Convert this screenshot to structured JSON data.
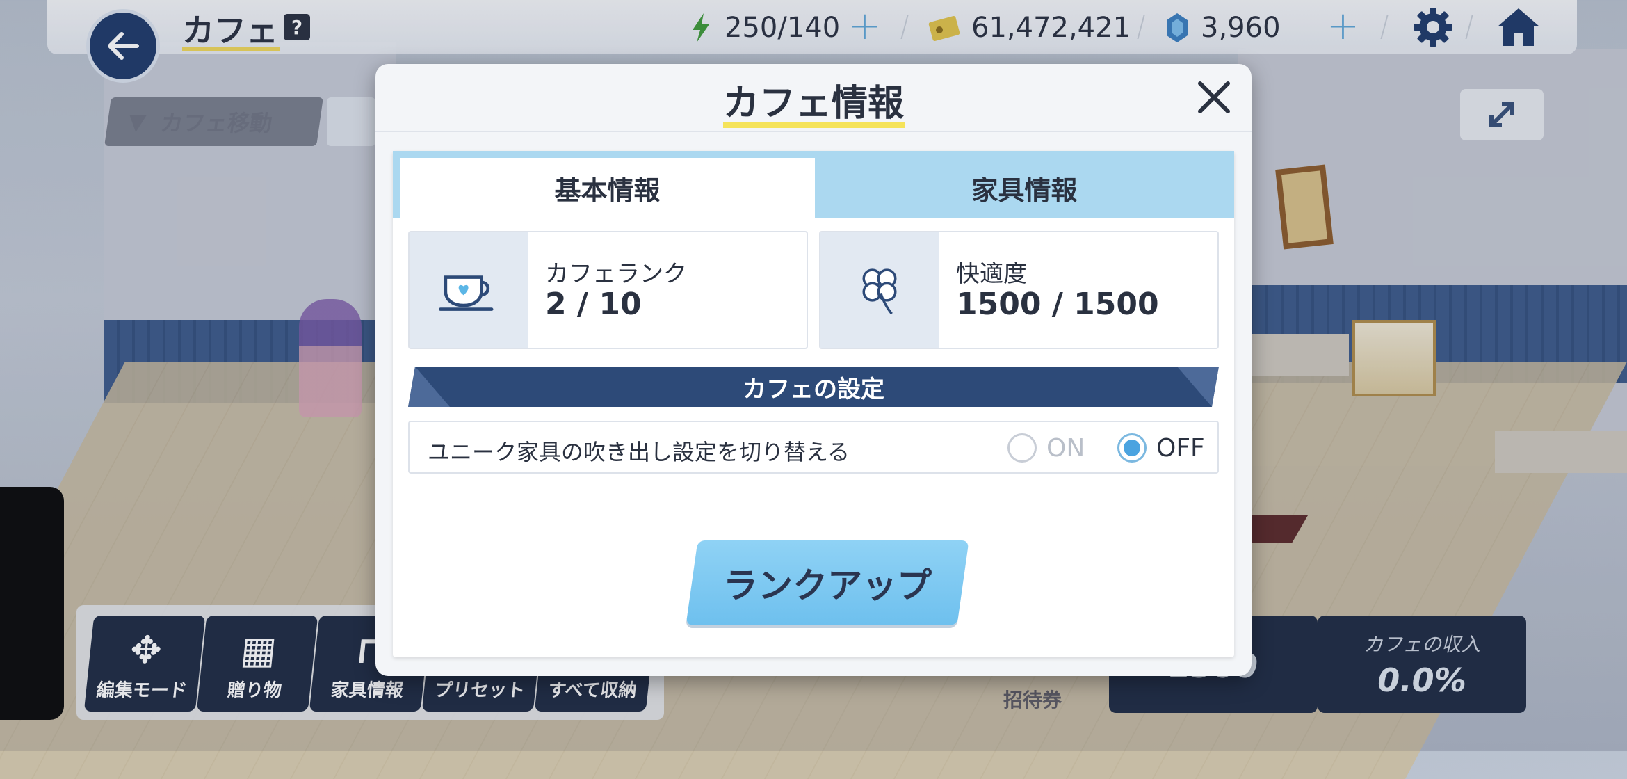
{
  "header": {
    "title": "カフェ",
    "help_label": "?",
    "stamina": "250/140",
    "credits": "61,472,421",
    "gems": "3,960",
    "plus_label": "+"
  },
  "left_controls": {
    "cafe_move_label": "カフェ移動"
  },
  "bottom_toolbar": {
    "items": [
      {
        "label": "編集モード",
        "icon": "move-arrows-icon"
      },
      {
        "label": "贈り物",
        "icon": "gift-icon"
      },
      {
        "label": "家具情報",
        "icon": "furniture-icon"
      },
      {
        "label": "プリセット",
        "icon": "preset-icon"
      },
      {
        "label": "すべて収納",
        "icon": "storage-icon"
      }
    ],
    "invite_label": "招待券",
    "stat_left_value": "1500",
    "income_label": "カフェの収入",
    "income_value": "0.0%"
  },
  "modal": {
    "title": "カフェ情報",
    "tabs": [
      {
        "label": "基本情報",
        "active": true
      },
      {
        "label": "家具情報",
        "active": false
      }
    ],
    "cafe_rank": {
      "label": "カフェランク",
      "value": "2 / 10",
      "icon": "teacup-heart-icon"
    },
    "comfort": {
      "label": "快適度",
      "value": "1500 / 1500",
      "icon": "clover-icon"
    },
    "settings_header": "カフェの設定",
    "setting": {
      "text": "ユニーク家具の吹き出し設定を切り替える",
      "on_label": "ON",
      "off_label": "OFF",
      "selected": "OFF"
    },
    "rankup_label": "ランクアップ"
  },
  "colors": {
    "accent_blue": "#6ec0ee",
    "tab_bg": "#abd8f0",
    "navy": "#2d4a78",
    "title_underline": "#f5e35a"
  }
}
